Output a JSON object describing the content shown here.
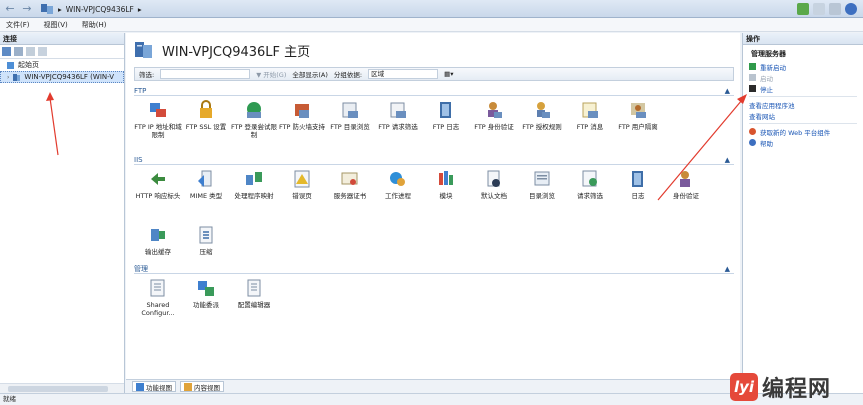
{
  "address": {
    "path": "WIN-VPJCQ9436LF",
    "sep": "▸"
  },
  "menu": [
    "文件(F)",
    "视图(V)",
    "帮助(H)"
  ],
  "left": {
    "header": "连接",
    "tree": [
      {
        "label": "起始页"
      },
      {
        "label": "WIN-VPJCQ9436LF (WIN-V"
      }
    ]
  },
  "center": {
    "title": "WIN-VPJCQ9436LF 主页",
    "filter": {
      "label": "筛选:",
      "go": "▼ 开始(G)",
      "show_all": "全部显示(A)",
      "group_label": "分组依据:",
      "group_value": "区域"
    },
    "sections": [
      {
        "name": "FTP",
        "items": [
          "FTP IP 地址和域限制",
          "FTP SSL 设置",
          "FTP 登录尝试限制",
          "FTP 防火墙支持",
          "FTP 目录浏览",
          "FTP 请求筛选",
          "FTP 日志",
          "FTP 身份验证",
          "FTP 授权规则",
          "FTP 消息",
          "FTP 用户隔离"
        ]
      },
      {
        "name": "IIS",
        "items": [
          "HTTP 响应标头",
          "MIME 类型",
          "处理程序映射",
          "错误页",
          "服务器证书",
          "工作进程",
          "模块",
          "默认文档",
          "目录浏览",
          "请求筛选",
          "日志",
          "身份验证",
          "输出缓存",
          "压缩"
        ]
      },
      {
        "name": "管理",
        "items": [
          "Shared Configur...",
          "功能委派",
          "配置编辑器"
        ]
      }
    ],
    "bottom_tabs": [
      "功能视图",
      "内容视图"
    ]
  },
  "right": {
    "header": "操作",
    "group_title": "管理服务器",
    "actions": [
      {
        "label": "重新启动",
        "enabled": true
      },
      {
        "label": "启动",
        "enabled": false
      },
      {
        "label": "停止",
        "enabled": true
      },
      {
        "label": "查看应用程序池",
        "enabled": true
      },
      {
        "label": "查看网站",
        "enabled": true
      },
      {
        "label": "获取新的 Web 平台组件",
        "enabled": true
      },
      {
        "label": "帮助",
        "enabled": true
      }
    ]
  },
  "status": "就绪",
  "watermark": {
    "logo": "lyi",
    "text": "编程网"
  },
  "colors": {
    "accent": "#1a56b5",
    "arrow": "#e23b2e",
    "section": "#2a5a95"
  }
}
